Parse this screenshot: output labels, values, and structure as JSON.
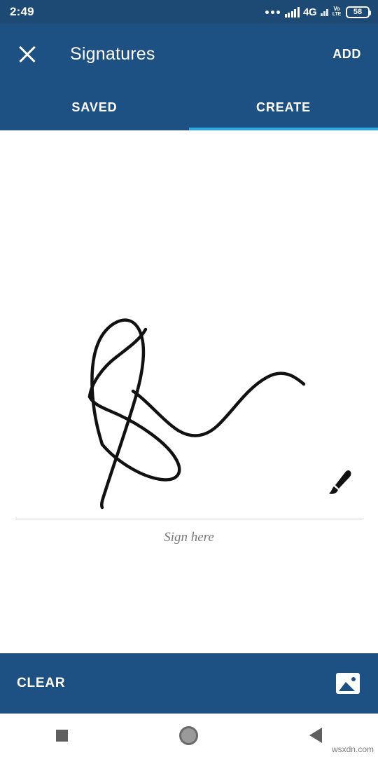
{
  "status_bar": {
    "time": "2:49",
    "network_label": "4G",
    "volte_top": "Vo",
    "volte_bottom": "LTE",
    "battery_level": "58",
    "icons": [
      "more-dots-icon",
      "signal-bars-icon",
      "signal-bars-secondary-icon",
      "volte-icon",
      "battery-icon"
    ]
  },
  "app_bar": {
    "close_icon": "close-icon",
    "title": "Signatures",
    "add_label": "ADD"
  },
  "tabs": {
    "items": [
      {
        "label": "SAVED",
        "selected": false
      },
      {
        "label": "CREATE",
        "selected": true
      }
    ],
    "indicator_color": "#29abe2"
  },
  "canvas": {
    "hint": "Sign here",
    "brush_icon": "brush-icon",
    "stroke_color": "#111111"
  },
  "bottom_bar": {
    "clear_label": "CLEAR",
    "gallery_icon": "image-icon"
  },
  "nav_bar": {
    "recents_icon": "square-recents-icon",
    "home_icon": "circle-home-icon",
    "back_icon": "triangle-back-icon"
  },
  "watermark": "wsxdn.com",
  "colors": {
    "status_bar": "#1d4a74",
    "app_bar": "#1d5183",
    "accent": "#29abe2",
    "canvas_bg": "#ffffff"
  }
}
